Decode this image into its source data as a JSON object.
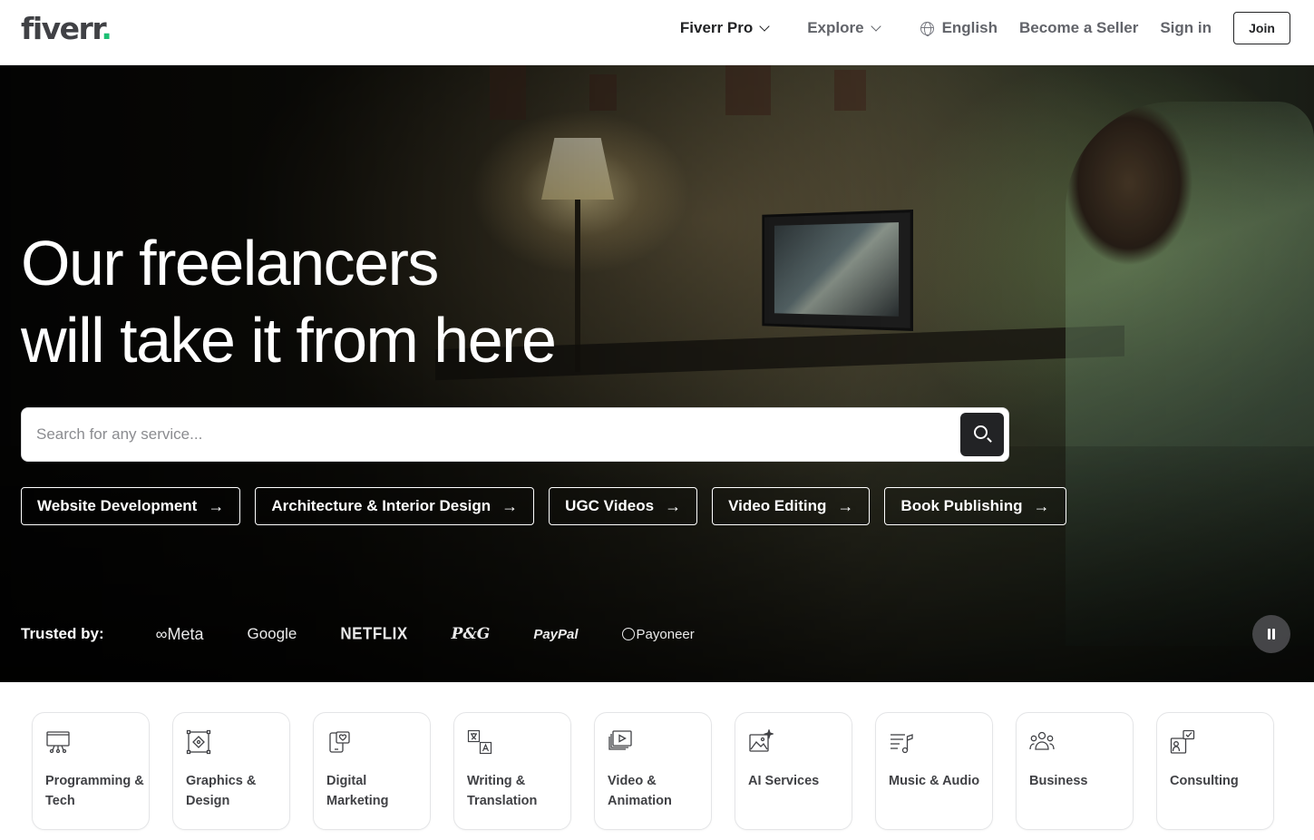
{
  "header": {
    "logo_text": "fiverr",
    "logo_dot": ".",
    "nav": {
      "fiverr_pro": "Fiverr Pro",
      "explore": "Explore",
      "language": "English",
      "become_seller": "Become a Seller",
      "sign_in": "Sign in",
      "join": "Join"
    }
  },
  "hero": {
    "title_line1": "Our freelancers",
    "title_line2": "will take it from here",
    "search": {
      "placeholder": "Search for any service..."
    },
    "quick_links": [
      {
        "label": "Website Development"
      },
      {
        "label": "Architecture & Interior Design"
      },
      {
        "label": "UGC Videos"
      },
      {
        "label": "Video Editing"
      },
      {
        "label": "Book Publishing"
      }
    ],
    "trusted_label": "Trusted by:",
    "brands": [
      "Meta",
      "Google",
      "NETFLIX",
      "P&G",
      "PayPal",
      "Payoneer"
    ]
  },
  "categories": [
    {
      "label": "Programming & Tech",
      "icon": "programming-icon"
    },
    {
      "label": "Graphics & Design",
      "icon": "graphics-icon"
    },
    {
      "label": "Digital Marketing",
      "icon": "marketing-icon"
    },
    {
      "label": "Writing & Translation",
      "icon": "translation-icon"
    },
    {
      "label": "Video & Animation",
      "icon": "video-icon"
    },
    {
      "label": "AI Services",
      "icon": "ai-image-icon"
    },
    {
      "label": "Music & Audio",
      "icon": "music-icon"
    },
    {
      "label": "Business",
      "icon": "people-icon"
    },
    {
      "label": "Consulting",
      "icon": "consulting-icon"
    }
  ],
  "colors": {
    "brand_green": "#1dbf73",
    "text_dark": "#222325",
    "text_grey": "#62646a"
  }
}
